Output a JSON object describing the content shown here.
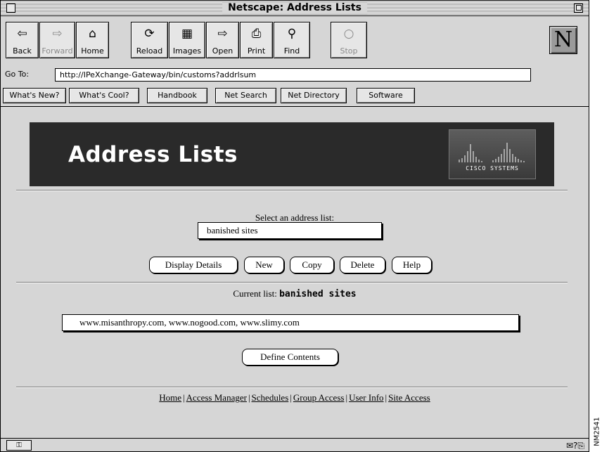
{
  "window": {
    "title": "Netscape: Address Lists"
  },
  "toolbar": {
    "back": {
      "label": "Back",
      "icon": "back-arrow-icon",
      "glyph": "⇦"
    },
    "forward": {
      "label": "Forward",
      "icon": "forward-arrow-icon",
      "glyph": "⇨"
    },
    "home": {
      "label": "Home",
      "icon": "home-icon",
      "glyph": "⌂"
    },
    "reload": {
      "label": "Reload",
      "icon": "reload-icon",
      "glyph": "⟳"
    },
    "images": {
      "label": "Images",
      "icon": "images-icon",
      "glyph": "▦"
    },
    "open": {
      "label": "Open",
      "icon": "open-icon",
      "glyph": "⇨"
    },
    "print": {
      "label": "Print",
      "icon": "printer-icon",
      "glyph": "⎙"
    },
    "find": {
      "label": "Find",
      "icon": "find-icon",
      "glyph": "⚲"
    },
    "stop": {
      "label": "Stop",
      "icon": "stop-icon",
      "glyph": "○"
    },
    "logo": "N"
  },
  "location": {
    "label": "Go To:",
    "url": "http://IPeXchange-Gateway/bin/customs?addrlsum"
  },
  "directory_buttons": [
    "What's New?",
    "What's Cool?",
    "Handbook",
    "Net Search",
    "Net Directory",
    "Software"
  ],
  "banner": {
    "title": "Address Lists",
    "logo_text": "CISCO SYSTEMS"
  },
  "select": {
    "prompt": "Select an address list:",
    "value": "banished sites"
  },
  "buttons": {
    "display_details": "Display Details",
    "new": "New",
    "copy": "Copy",
    "delete": "Delete",
    "help": "Help"
  },
  "current": {
    "prefix": "Current list:",
    "name": "banished sites",
    "contents": "www.misanthropy.com, www.nogood.com, www.slimy.com"
  },
  "define_contents": "Define Contents",
  "footer_links": [
    "Home",
    "Access Manager",
    "Schedules",
    "Group Access",
    "User Info",
    "Site Access"
  ],
  "statusbar": {
    "security_icon": "broken-key-icon",
    "right_glyphs": "✉?⎘"
  },
  "side_label": "NM2541",
  "colors": {
    "window_bg": "#d6d6d6",
    "banner_bg": "#2a2a2a",
    "field_bg": "#ffffff"
  }
}
